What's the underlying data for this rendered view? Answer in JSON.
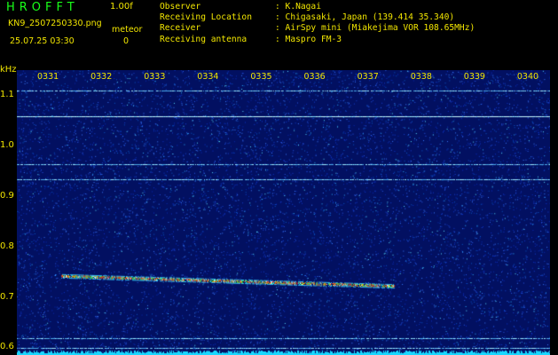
{
  "header": {
    "app_name": "HROFFT",
    "version": "1.00f",
    "file_name": "KN9_2507250330.png",
    "mode": "meteor",
    "datetime": "25.07.25 03:30",
    "count": "0"
  },
  "station_info": [
    {
      "label": "Observer",
      "value": ": K.Nagai"
    },
    {
      "label": "Receiving Location",
      "value": ": Chigasaki, Japan (139.414 35.340)"
    },
    {
      "label": "Receiver",
      "value": ": AirSpy mini (Miakejima VOR 108.65MHz)"
    },
    {
      "label": "Receiving antenna",
      "value": ": Maspro FM-3"
    }
  ],
  "chart_data": {
    "type": "heatmap",
    "ylabel": "kHz",
    "y_ticks": [
      "1.1",
      "1.0",
      "0.9",
      "0.8",
      "0.7",
      "0.6"
    ],
    "x_ticks": [
      "0331",
      "0332",
      "0333",
      "0334",
      "0335",
      "0336",
      "0337",
      "0338",
      "0339",
      "0340"
    ],
    "ylim": [
      0.585,
      1.15
    ],
    "colors": {
      "background": "#021061",
      "text": "#f2e600",
      "noise_floor": "#18d8ff"
    },
    "carriers_khz": [
      1.109,
      1.058,
      0.963,
      0.933,
      0.618,
      0.599
    ],
    "echo": {
      "start_time": "03:30:50",
      "end_time": "03:37:05",
      "freq_start_khz": 0.742,
      "freq_end_khz": 0.722
    }
  }
}
